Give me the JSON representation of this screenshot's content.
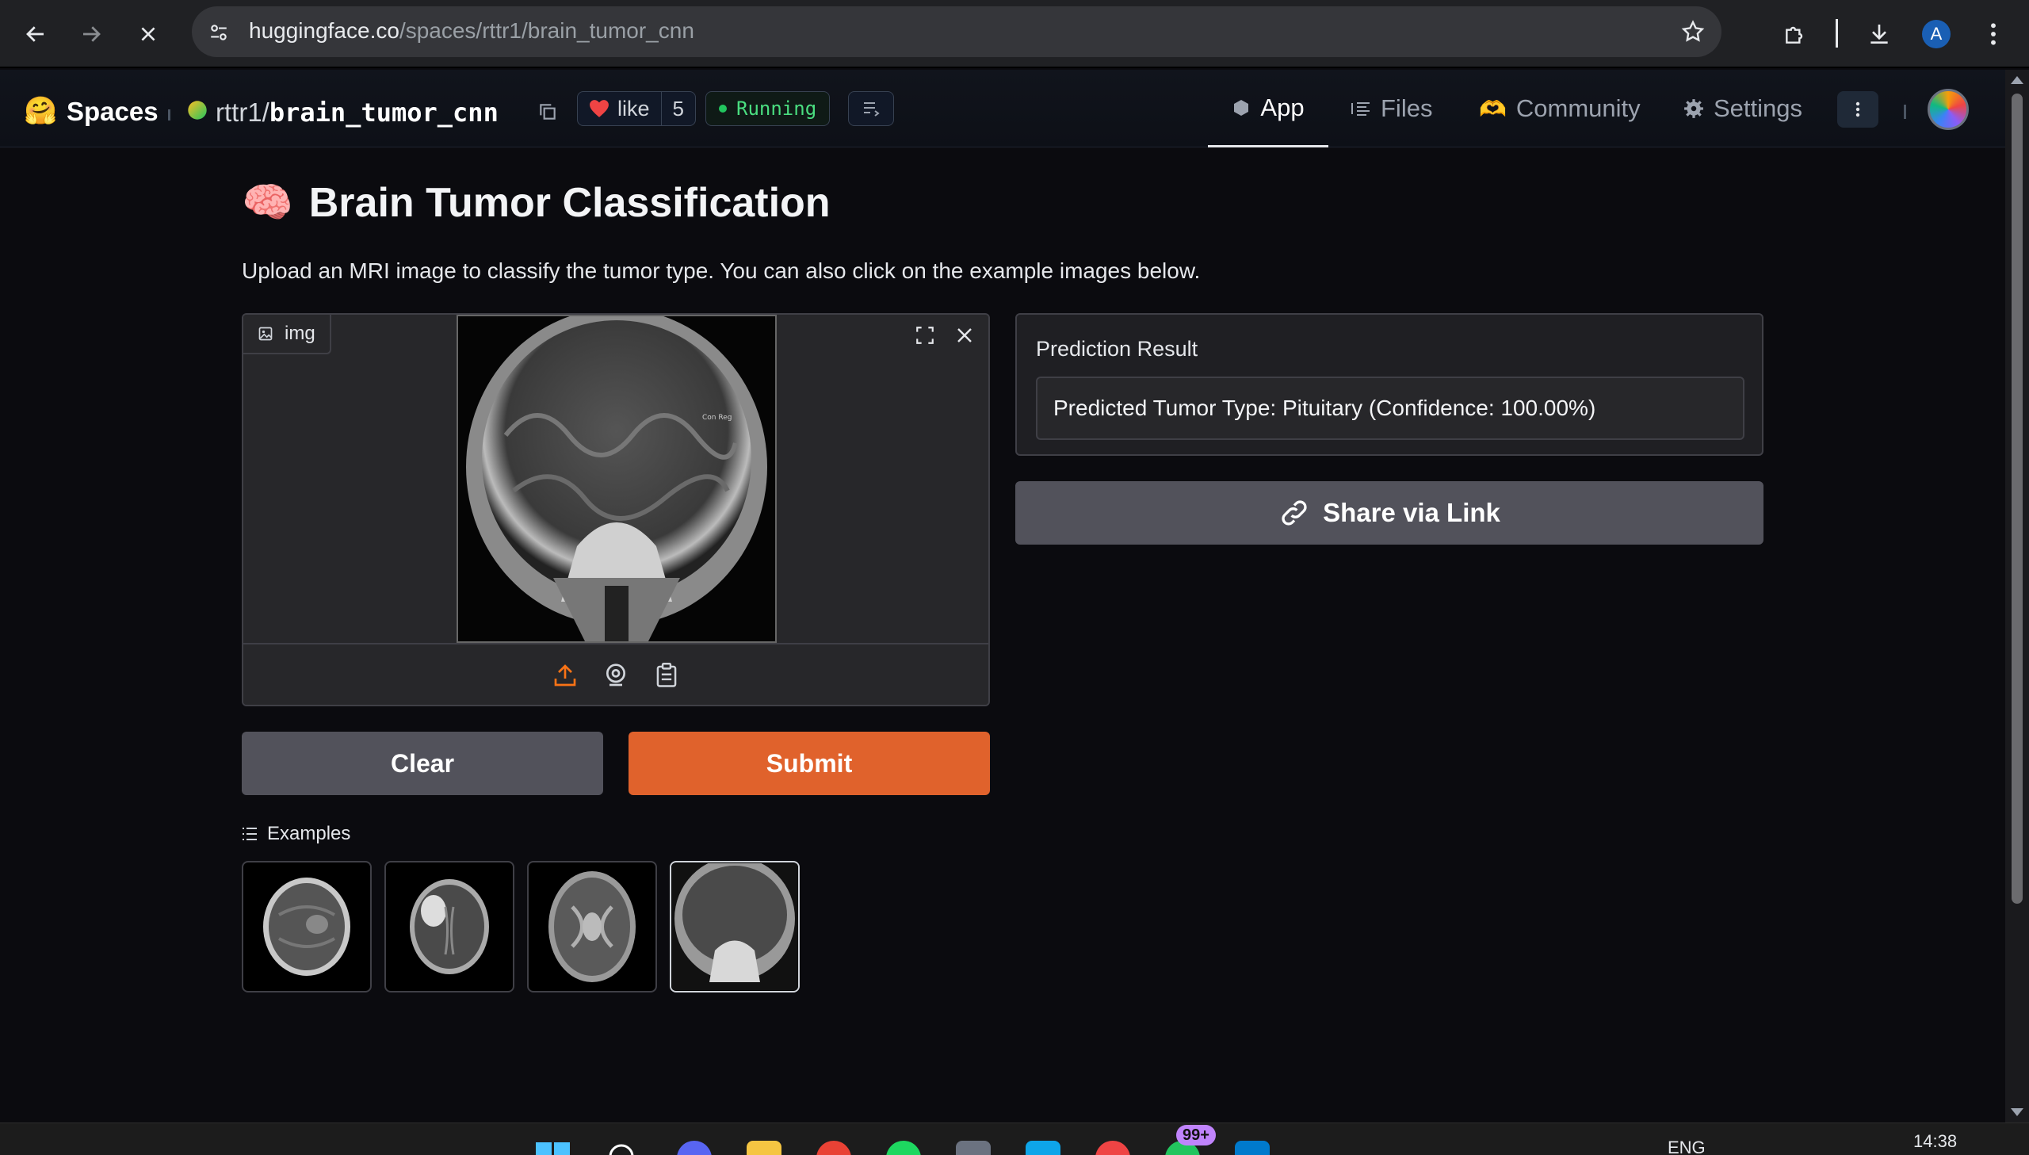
{
  "browser": {
    "url_host": "huggingface.co",
    "url_path": "/spaces/rttr1/brain_tumor_cnn",
    "profile_initial": "A"
  },
  "hf_header": {
    "logo": "🤗",
    "spaces_label": "Spaces",
    "owner": "rttr1",
    "slash": "/",
    "space_name": "brain_tumor_cnn",
    "like_label": "like",
    "like_count": "5",
    "status": "Running",
    "tabs": [
      {
        "label": "App",
        "icon": "cube-icon",
        "active": true
      },
      {
        "label": "Files",
        "icon": "files-icon",
        "active": false
      },
      {
        "label": "Community",
        "icon": "community-icon",
        "active": false
      },
      {
        "label": "Settings",
        "icon": "gear-icon",
        "active": false
      }
    ]
  },
  "app": {
    "title_emoji": "🧠",
    "title": "Brain Tumor Classification",
    "description": "Upload an MRI image to classify the tumor type. You can also click on the example images below.",
    "image_input": {
      "label": "img"
    },
    "result": {
      "label": "Prediction Result",
      "value": "Predicted Tumor Type: Pituitary (Confidence: 100.00%)"
    },
    "share_label": "Share via Link",
    "clear_label": "Clear",
    "submit_label": "Submit",
    "examples_label": "Examples",
    "examples": [
      "example-1",
      "example-2",
      "example-3",
      "example-4"
    ]
  },
  "taskbar": {
    "language": "ENG",
    "time": "14:38",
    "badge": "99+"
  },
  "colors": {
    "accent": "#e0622c",
    "secondary_button": "#52525b",
    "status_green": "#4ade80"
  }
}
